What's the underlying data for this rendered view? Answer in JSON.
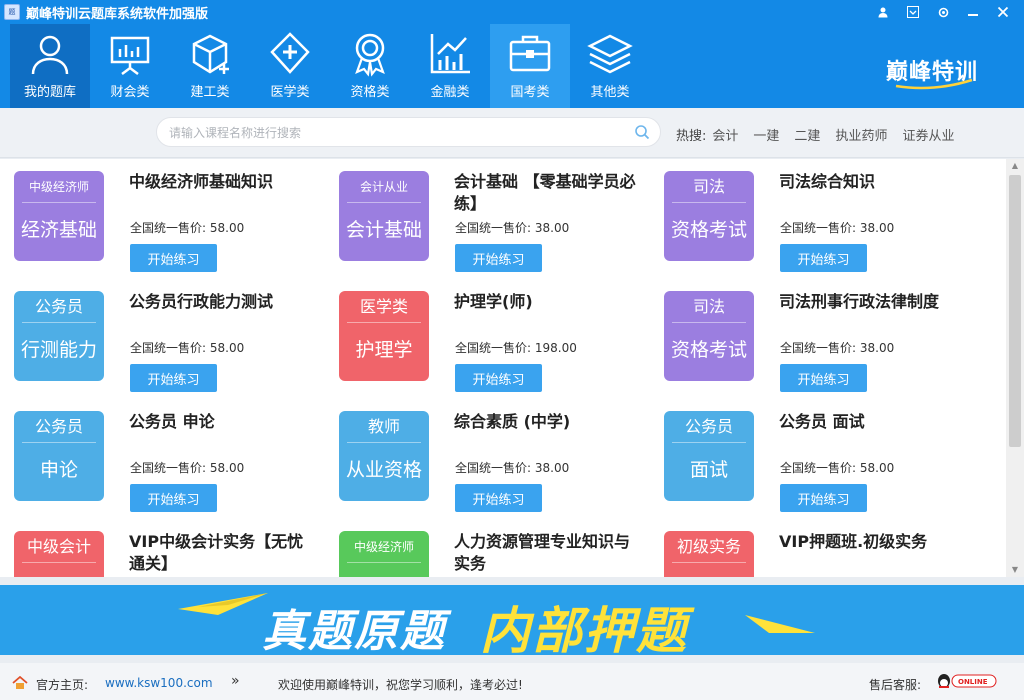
{
  "window": {
    "title": "巅峰特训云题库系统软件加强版",
    "icon_name": "app-logo-icon",
    "controls": [
      "user-icon",
      "menu-icon",
      "settings-icon",
      "minimize-icon",
      "close-icon"
    ]
  },
  "nav": {
    "items": [
      {
        "label": "我的题库",
        "icon": "user-icon"
      },
      {
        "label": "财会类",
        "icon": "presentation-chart-icon"
      },
      {
        "label": "建工类",
        "icon": "cube-plus-icon"
      },
      {
        "label": "医学类",
        "icon": "medical-cross-icon"
      },
      {
        "label": "资格类",
        "icon": "award-medal-icon"
      },
      {
        "label": "金融类",
        "icon": "bar-chart-trend-icon"
      },
      {
        "label": "国考类",
        "icon": "briefcase-icon"
      },
      {
        "label": "其他类",
        "icon": "layers-icon"
      }
    ],
    "brand": "巅峰特训"
  },
  "search": {
    "placeholder": "请输入课程名称进行搜索",
    "hot_label": "热搜:",
    "hot_items": [
      "会计",
      "一建",
      "二建",
      "执业药师",
      "证券从业"
    ]
  },
  "courses": [
    {
      "title": "中级经济师基础知识",
      "price": "全国统一售价: 58.00",
      "button": "开始练习",
      "thumb_top": "中级经济师",
      "thumb_bottom": "经济基础",
      "color": "#9b7ee0"
    },
    {
      "title": "会计基础 【零基础学员必练】",
      "price": "全国统一售价: 38.00",
      "button": "开始练习",
      "thumb_top": "会计从业",
      "thumb_bottom": "会计基础",
      "color": "#9b7ee0"
    },
    {
      "title": "司法综合知识",
      "price": "全国统一售价: 38.00",
      "button": "开始练习",
      "thumb_top": "司法",
      "thumb_bottom": "资格考试",
      "color": "#9b7ee0"
    },
    {
      "title": "公务员行政能力测试",
      "price": "全国统一售价: 58.00",
      "button": "开始练习",
      "thumb_top": "公务员",
      "thumb_bottom": "行测能力",
      "color": "#4eaee6"
    },
    {
      "title": "护理学(师)",
      "price": "全国统一售价: 198.00",
      "button": "开始练习",
      "thumb_top": "医学类",
      "thumb_bottom": "护理学",
      "color": "#f0646a"
    },
    {
      "title": "司法刑事行政法律制度",
      "price": "全国统一售价: 38.00",
      "button": "开始练习",
      "thumb_top": "司法",
      "thumb_bottom": "资格考试",
      "color": "#9b7ee0"
    },
    {
      "title": "公务员 申论",
      "price": "全国统一售价: 58.00",
      "button": "开始练习",
      "thumb_top": "公务员",
      "thumb_bottom": "申论",
      "color": "#4eaee6"
    },
    {
      "title": "综合素质 (中学)",
      "price": "全国统一售价: 38.00",
      "button": "开始练习",
      "thumb_top": "教师",
      "thumb_bottom": "从业资格",
      "color": "#4eaee6"
    },
    {
      "title": "公务员 面试",
      "price": "全国统一售价: 58.00",
      "button": "开始练习",
      "thumb_top": "公务员",
      "thumb_bottom": "面试",
      "color": "#4eaee6"
    },
    {
      "title": "VIP中级会计实务【无忧通关】",
      "price": "",
      "button": "",
      "thumb_top": "中级会计",
      "thumb_bottom": "",
      "color": "#f0646a"
    },
    {
      "title": "人力资源管理专业知识与实务",
      "price": "",
      "button": "",
      "thumb_top": "中级经济师",
      "thumb_bottom": "",
      "color": "#58c95b"
    },
    {
      "title": "VIP押题班.初级实务",
      "price": "",
      "button": "",
      "thumb_top": "初级实务",
      "thumb_bottom": "",
      "color": "#f0646a"
    }
  ],
  "banner": {
    "text_white": "真题原题",
    "text_yellow": "内部押题"
  },
  "footer": {
    "home_label": "官方主页:",
    "home_link": "www.ksw100.com",
    "welcome": "欢迎使用巅峰特训，祝您学习顺利，逢考必过!",
    "service_label": "售后客服:",
    "qq_status": "ONLINE"
  }
}
